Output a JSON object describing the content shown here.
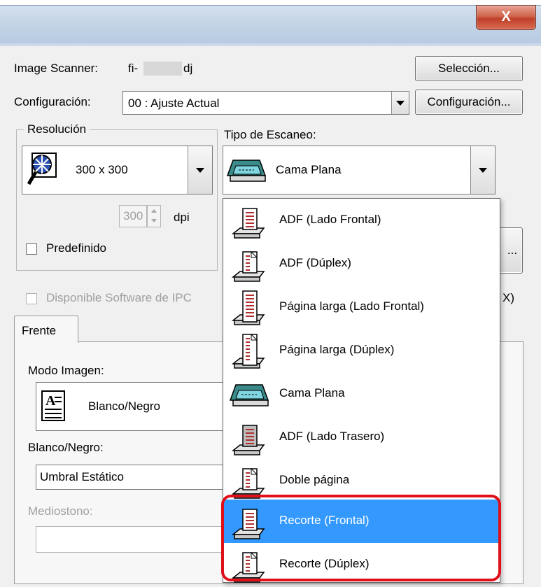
{
  "window": {
    "close_label": "X"
  },
  "scanner": {
    "label": "Image Scanner:",
    "model_prefix": "fi-",
    "model_suffix": "dj",
    "select_button": "Selección..."
  },
  "config": {
    "label": "Configuración:",
    "value": "00 : Ajuste Actual",
    "button": "Configuración..."
  },
  "resolution": {
    "group_label": "Resolución",
    "value": "300 x 300",
    "dpi_value": "300",
    "dpi_unit": "dpi",
    "predefined_label": "Predefinido"
  },
  "scan_type": {
    "label": "Tipo de Escaneo:",
    "selected": "Cama Plana",
    "options": [
      {
        "label": "ADF (Lado Frontal)",
        "icon": "adf-front-icon"
      },
      {
        "label": "ADF (Dúplex)",
        "icon": "adf-duplex-icon"
      },
      {
        "label": "Página larga (Lado Frontal)",
        "icon": "long-page-front-icon"
      },
      {
        "label": "Página larga (Dúplex)",
        "icon": "long-page-duplex-icon"
      },
      {
        "label": "Cama Plana",
        "icon": "flatbed-icon"
      },
      {
        "label": "ADF (Lado Trasero)",
        "icon": "adf-back-icon"
      },
      {
        "label": "Doble página",
        "icon": "double-page-icon"
      },
      {
        "label": "Recorte (Frontal)",
        "icon": "crop-front-icon"
      },
      {
        "label": "Recorte (Dúplex)",
        "icon": "crop-duplex-icon"
      }
    ],
    "highlighted_index": 7
  },
  "ipc": {
    "label": "Disponible  Software de IPC",
    "suffix": "X)"
  },
  "side_button": "...",
  "tabs": {
    "front": "Frente"
  },
  "image_mode": {
    "label": "Modo Imagen:",
    "value": "Blanco/Negro"
  },
  "bw": {
    "label": "Blanco/Negro:",
    "value": "Umbral Estático"
  },
  "halftone": {
    "label": "Mediostono:",
    "value": ""
  },
  "colors": {
    "selection": "#3399ff",
    "highlight_border": "#e0101a"
  }
}
